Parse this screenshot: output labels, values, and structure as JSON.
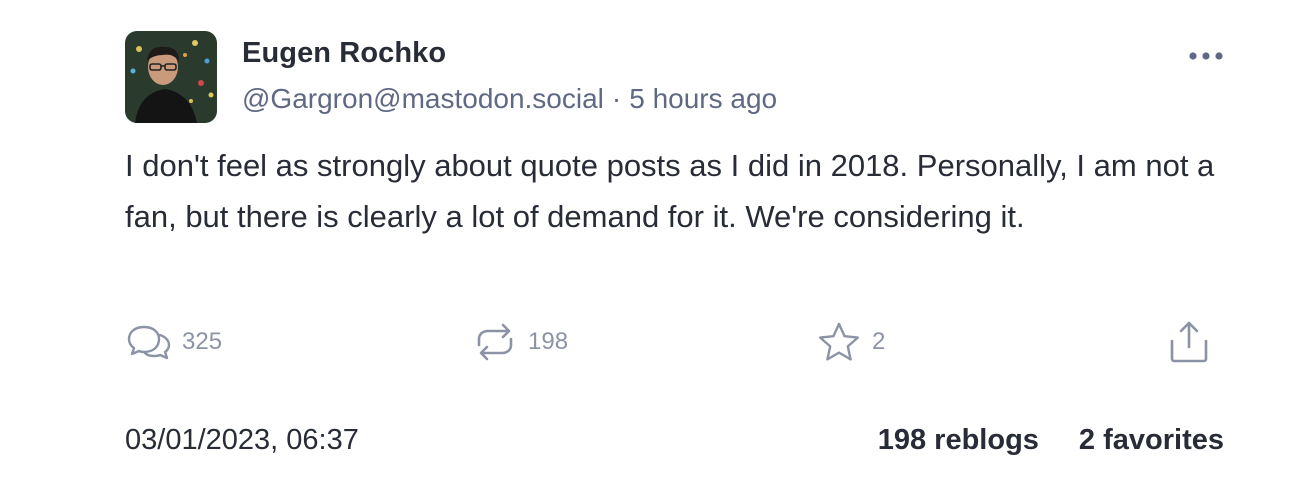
{
  "author": {
    "display_name": "Eugen Rochko",
    "handle": "@Gargron@mastodon.social",
    "separator": "·",
    "relative_time": "5 hours ago",
    "avatar_icon": "user-avatar"
  },
  "post": {
    "text": "I don't feel as strongly about quote posts as I did in 2018. Personally, I am not a fan, but there is clearly a lot of demand for it. We're considering it."
  },
  "actions": {
    "reply": {
      "icon": "reply-icon",
      "count": "325"
    },
    "reblog": {
      "icon": "reblog-icon",
      "count": "198"
    },
    "favorite": {
      "icon": "star-icon",
      "count": "2"
    },
    "share": {
      "icon": "share-icon"
    },
    "more": {
      "icon": "more-icon"
    }
  },
  "footer": {
    "timestamp": "03/01/2023, 06:37",
    "reblogs": "198 reblogs",
    "favorites": "2 favorites"
  },
  "colors": {
    "text": "#282c37",
    "muted": "#606984",
    "icon": "#8d93a6"
  }
}
